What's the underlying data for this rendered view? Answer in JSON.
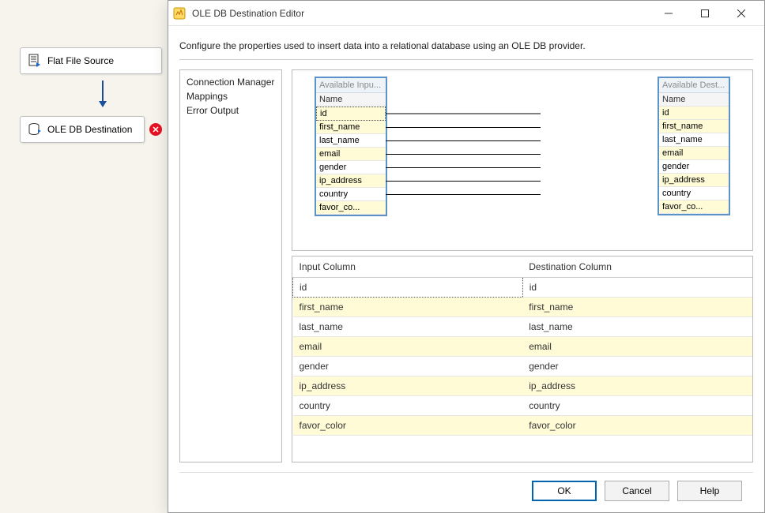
{
  "flow": {
    "source_label": "Flat File Source",
    "dest_label": "OLE DB Destination"
  },
  "dialog": {
    "title": "OLE DB Destination Editor",
    "description": "Configure the properties used to insert data into a relational database using an OLE DB provider.",
    "nav": {
      "items": [
        "Connection Manager",
        "Mappings",
        "Error Output"
      ]
    },
    "mapper": {
      "input_header": "Available Inpu...",
      "dest_header": "Available Dest...",
      "name_label": "Name",
      "columns": [
        "id",
        "first_name",
        "last_name",
        "email",
        "gender",
        "ip_address",
        "country",
        "favor_co..."
      ]
    },
    "grid": {
      "header_input": "Input Column",
      "header_dest": "Destination Column",
      "rows": [
        {
          "in": "id",
          "out": "id"
        },
        {
          "in": "first_name",
          "out": "first_name"
        },
        {
          "in": "last_name",
          "out": "last_name"
        },
        {
          "in": "email",
          "out": "email"
        },
        {
          "in": "gender",
          "out": "gender"
        },
        {
          "in": "ip_address",
          "out": "ip_address"
        },
        {
          "in": "country",
          "out": "country"
        },
        {
          "in": "favor_color",
          "out": "favor_color"
        }
      ]
    },
    "buttons": {
      "ok": "OK",
      "cancel": "Cancel",
      "help": "Help"
    }
  }
}
